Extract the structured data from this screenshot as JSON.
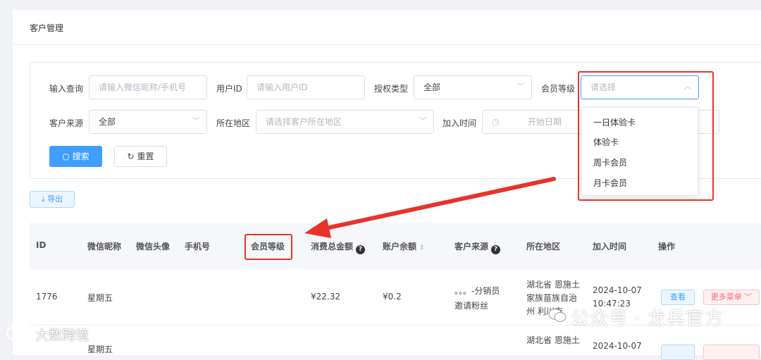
{
  "page": {
    "title": "客户管理"
  },
  "filters": {
    "query_label": "输入查询",
    "query_placeholder": "请输入微信昵称/手机号",
    "user_id_label": "用户ID",
    "user_id_placeholder": "请输入用户ID",
    "auth_label": "授权类型",
    "auth_value": "全部",
    "level_label": "会员等级",
    "level_placeholder": "请选择",
    "source_label": "客户来源",
    "source_value": "全部",
    "region_label": "所在地区",
    "region_placeholder": "请选择客户所在地区",
    "join_label": "加入时间",
    "start_placeholder": "开始日期"
  },
  "level_dropdown": {
    "options": [
      "一日体验卡",
      "体验卡",
      "周卡会员",
      "月卡会员"
    ]
  },
  "buttons": {
    "search": "搜索",
    "reset": "重置",
    "export": "导出"
  },
  "table": {
    "columns": [
      "ID",
      "微信昵称",
      "微信头像",
      "手机号",
      "会员等级",
      "消费总金额",
      "账户余额",
      "客户来源",
      "所在地区",
      "加入时间",
      "操作"
    ],
    "rows": [
      {
        "id": "1776",
        "nickname": "星期五",
        "total": "¥22.32",
        "balance": "¥0.2",
        "source_line1": "。。。-分销员",
        "source_line2": "邀请粉丝",
        "region_line1": "湖北省 恩施土",
        "region_line2": "家族苗族自治",
        "region_line3": "州 利川市",
        "date": "2024-10-07",
        "time": "10:47:23",
        "view": "查看",
        "more": "更多菜单"
      },
      {
        "nickname": "星期五",
        "region_line1": "湖北省 恩施土",
        "date": "2024-10-07"
      }
    ]
  },
  "watermark": {
    "right": "公众号 · 龙兵官方",
    "left": "大数跨境"
  },
  "colors": {
    "primary": "#409eff",
    "highlight": "#e8322a",
    "danger": "#f56c6c"
  }
}
